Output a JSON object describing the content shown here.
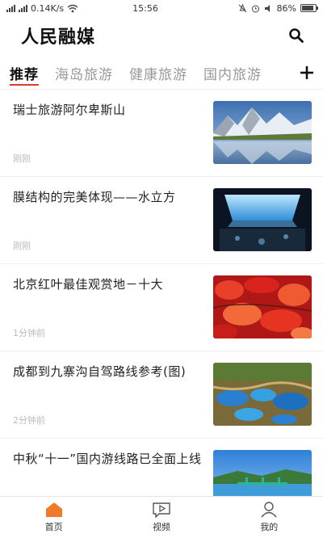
{
  "status_bar": {
    "speed": "0.14K/s",
    "time": "15:56",
    "battery": "86%",
    "battery_level": 0.86
  },
  "header": {
    "title": "人民融媒"
  },
  "tabs": [
    {
      "label": "推荐",
      "active": true
    },
    {
      "label": "海岛旅游",
      "active": false
    },
    {
      "label": "健康旅游",
      "active": false
    },
    {
      "label": "国内旅游",
      "active": false
    }
  ],
  "news": [
    {
      "title": "瑞士旅游阿尔卑斯山",
      "time": "刚刚",
      "image": "mountain-lake"
    },
    {
      "title": "膜结构的完美体现——水立方",
      "time": "刚刚",
      "image": "water-cube"
    },
    {
      "title": "北京红叶最佳观赏地－十大",
      "time": "1分钟前",
      "image": "red-leaves"
    },
    {
      "title": "成都到九寨沟自驾路线参考(图)",
      "time": "2分钟前",
      "image": "jiuzhaigou"
    },
    {
      "title": "中秋“十一”国内游线路已全面上线",
      "time": "",
      "image": "lake-bridge"
    }
  ],
  "bottom_nav": [
    {
      "label": "首页",
      "icon": "home-icon",
      "active": true
    },
    {
      "label": "视频",
      "icon": "video-icon",
      "active": false
    },
    {
      "label": "我的",
      "icon": "profile-icon",
      "active": false
    }
  ],
  "colors": {
    "accent": "#e03a2e",
    "home_icon": "#f07a2a"
  }
}
